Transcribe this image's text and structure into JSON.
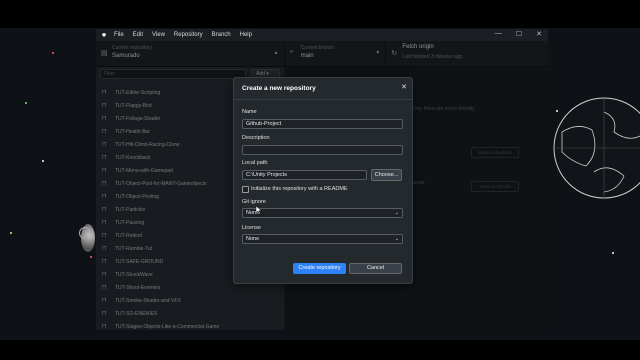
{
  "menubar": {
    "items": [
      "File",
      "Edit",
      "View",
      "Repository",
      "Branch",
      "Help"
    ],
    "window_controls": [
      "—",
      "☐",
      "✕"
    ]
  },
  "toolbar": {
    "current_repository_label": "Current repository",
    "current_repository_value": "Samurado",
    "current_branch_label": "Current branch",
    "current_branch_value": "main",
    "fetch_label": "Fetch origin",
    "fetch_sub": "Last fetched 3 minutes ago"
  },
  "sidebar": {
    "filter_placeholder": "Filter",
    "add_label": "Add ▾",
    "repos": [
      "TUT-Editor-Scripting",
      "TUT-Flappy-Bird",
      "TUT-Foliage-Shader",
      "TUT-Health-Bar",
      "TUT-Hill-Climb-Racing-Clone",
      "TUT-Knockback",
      "TUT-Menu-with-Gamepad",
      "TUT-Object-Pool-for-MANY-Gameobjects",
      "TUT-Object-Pooling",
      "TUT-Particles",
      "TUT-Pausing",
      "TUT-Rebind",
      "TUT-Rumble-Tut",
      "TUT-SAFE-GROUND",
      "TUT-ShockWave",
      "TUT-Shoot-Enemies",
      "TUT-Smoke-Shader-and-VFX",
      "TUT-SO-ENEMIES",
      "TUT-Stages-Objects-Like-a-Commercial-Game"
    ]
  },
  "main": {
    "hint1": "pository. Here are some friendly",
    "hint2": "ce",
    "hint3": "r browser",
    "button1": "Show in Explorer",
    "button2": "View on GitHub"
  },
  "dialog": {
    "title": "Create a new repository",
    "name_label": "Name",
    "name_value": "Github-Project",
    "description_label": "Description",
    "description_value": "",
    "local_path_label": "Local path",
    "local_path_value": "C:\\Unity Projects",
    "choose_label": "Choose...",
    "readme_label": "Initialize this repository with a README",
    "gitignore_label": "Git ignore",
    "gitignore_value": "None",
    "license_label": "License",
    "license_value": "None",
    "create_label": "Create repository",
    "cancel_label": "Cancel"
  },
  "colors": {
    "primary_button": "#2f81f7",
    "window_bg": "#24292e"
  }
}
